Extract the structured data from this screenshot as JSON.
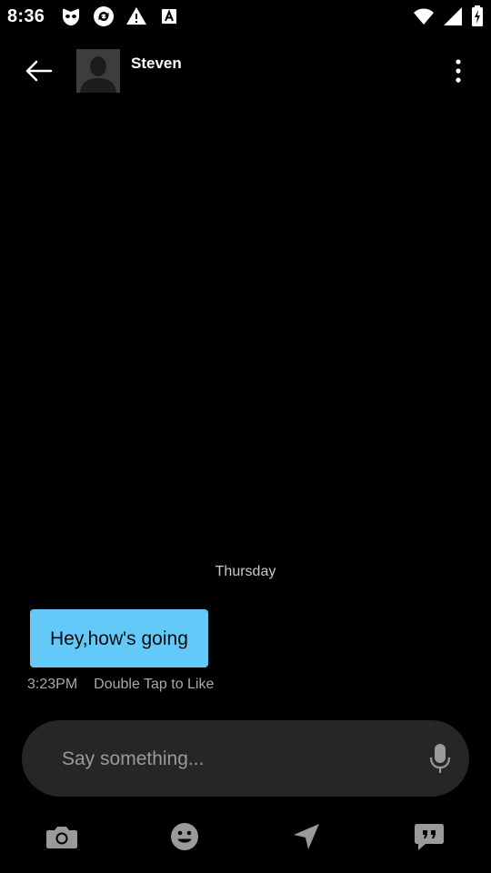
{
  "status_bar": {
    "time": "8:36",
    "icons": [
      "grindr-mask-icon",
      "sync-icon",
      "warning-icon",
      "font-a-icon",
      "wifi-icon",
      "signal-icon",
      "battery-icon"
    ]
  },
  "header": {
    "contact_name": "Steven",
    "back_icon": "arrow-left-icon",
    "menu_icon": "more-vertical-icon"
  },
  "conversation": {
    "day_separator": "Thursday",
    "messages": [
      {
        "text": "Hey,how's going",
        "time": "3:23PM",
        "hint": "Double Tap to Like",
        "bubble_color": "#62c9f9"
      }
    ]
  },
  "composer": {
    "placeholder": "Say something...",
    "value": "",
    "mic_icon": "microphone-icon"
  },
  "toolbar": {
    "icons": [
      "camera-icon",
      "emoji-icon",
      "location-send-icon",
      "saved-phrases-icon"
    ]
  },
  "colors": {
    "background": "#000000",
    "bubble": "#62c9f9",
    "composer": "#262626",
    "icon_gray": "#9a9a9a"
  }
}
